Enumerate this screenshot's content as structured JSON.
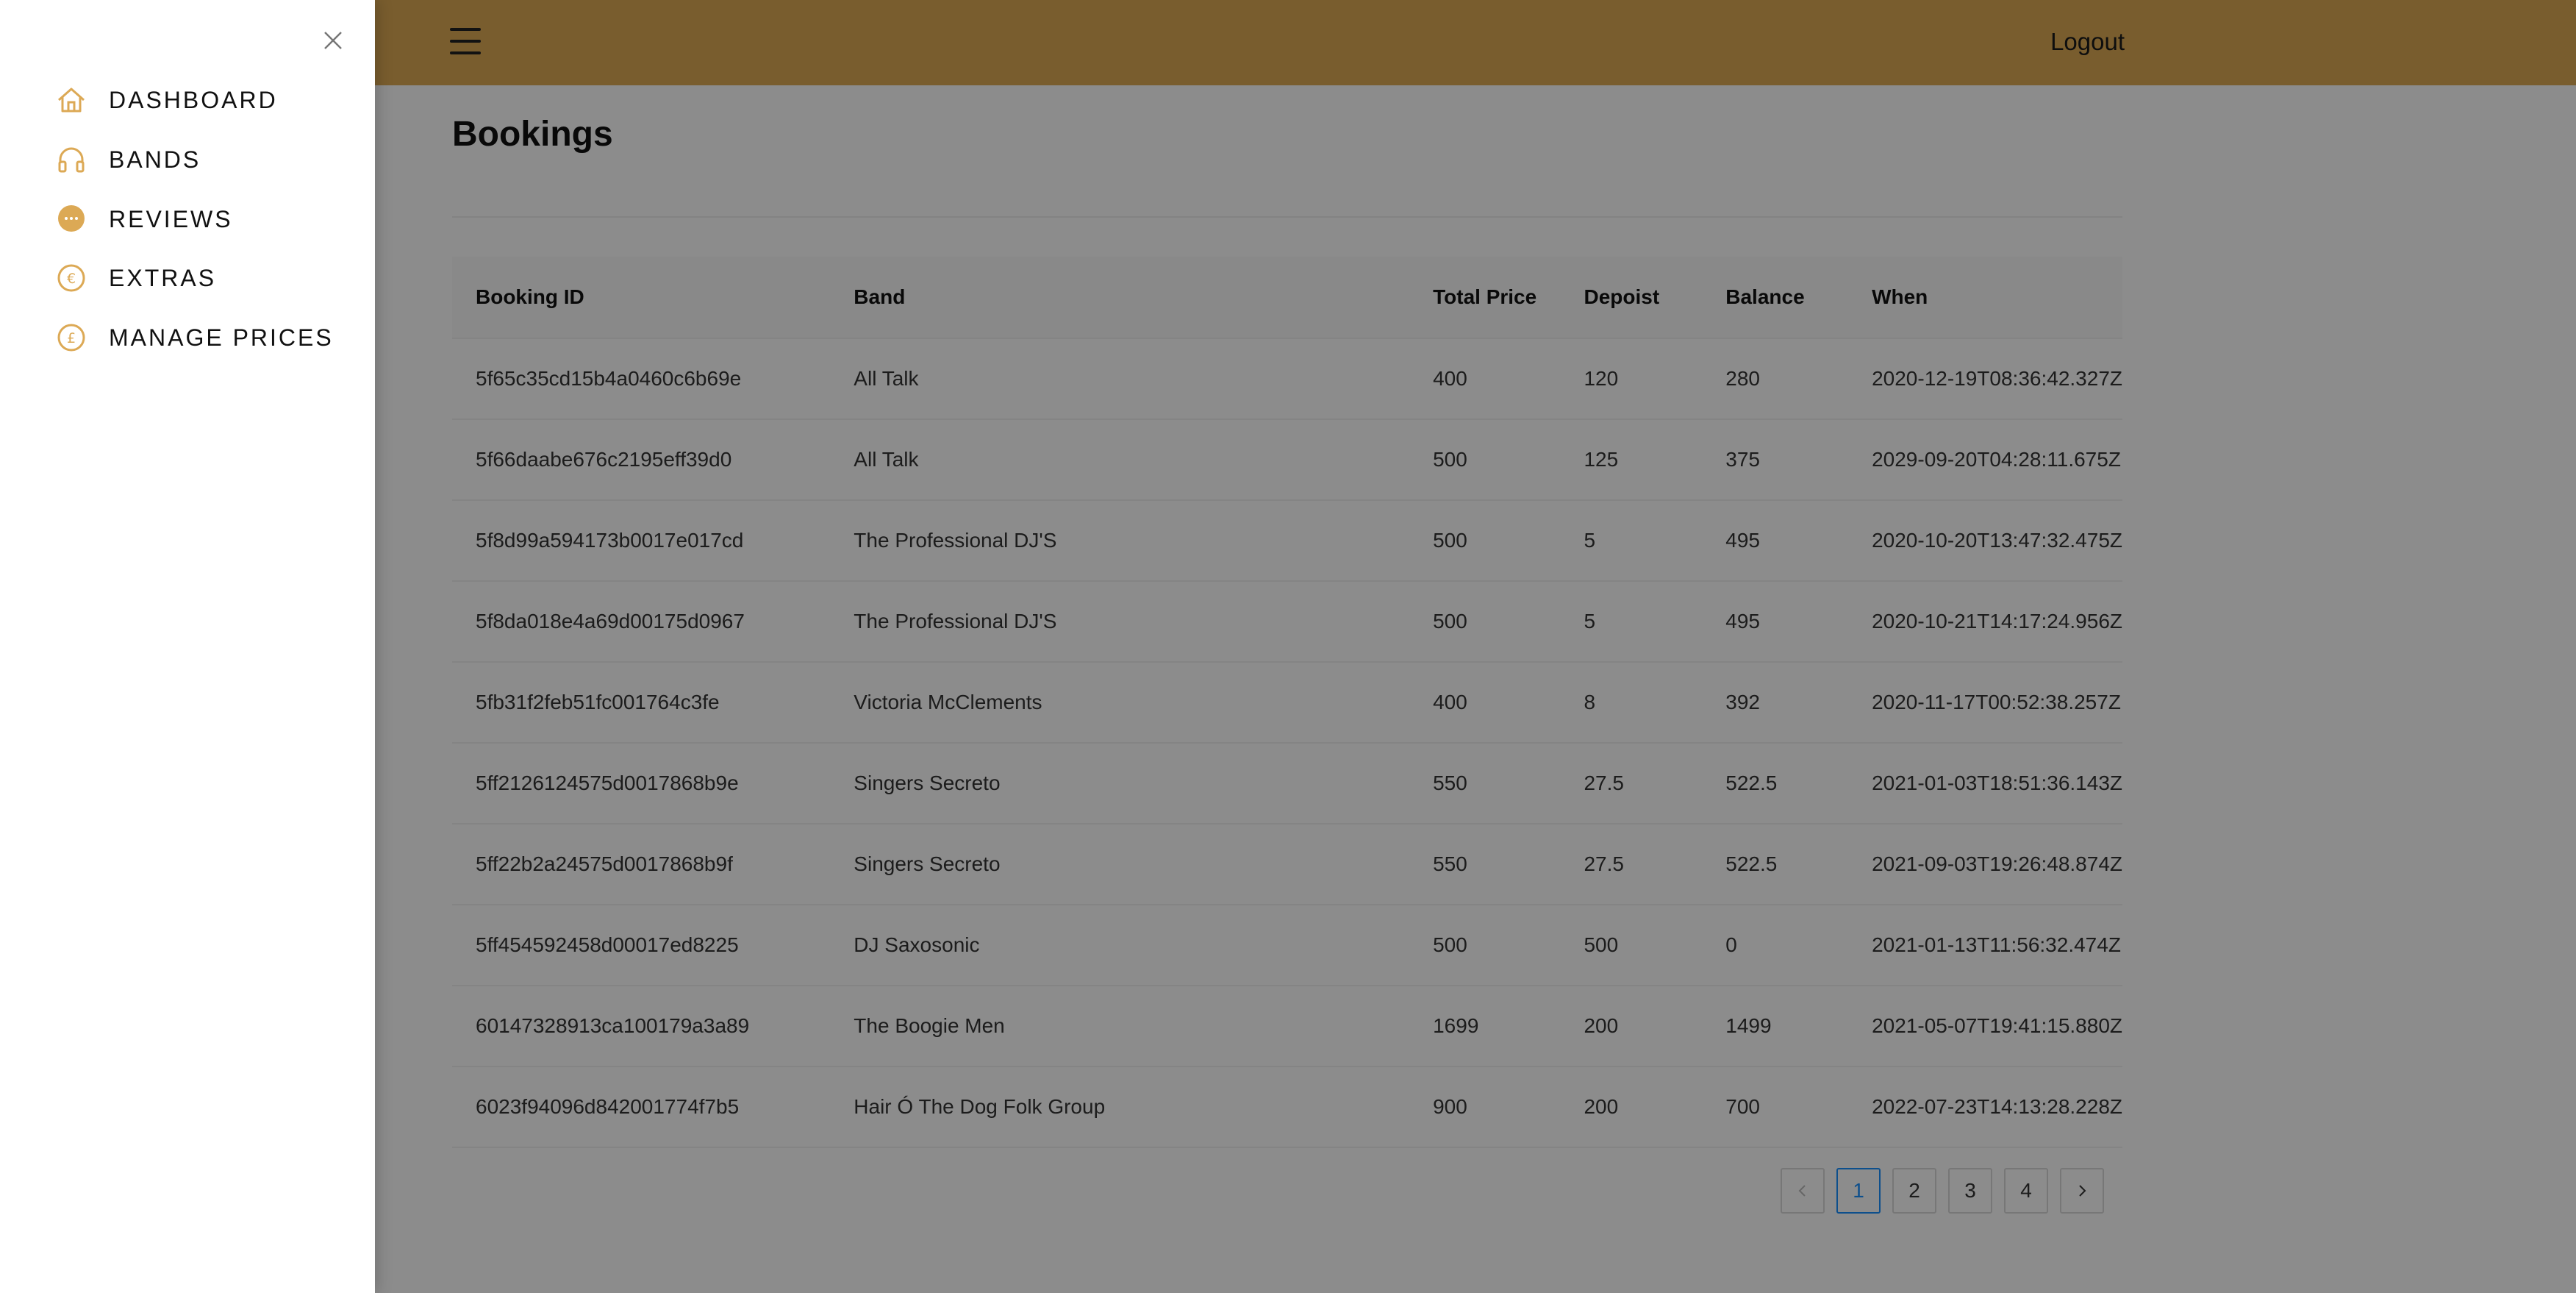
{
  "colors": {
    "accent": "#dca955",
    "header_bg": "#dca955",
    "pagination_active": "#1890ff",
    "mask": "rgba(0,0,0,0.45)"
  },
  "header": {
    "menu_icon": "hamburger-icon",
    "logout_label": "Logout"
  },
  "page": {
    "title": "Bookings"
  },
  "table": {
    "columns": [
      "Booking ID",
      "Band",
      "Total Price",
      "Depoist",
      "Balance",
      "When"
    ],
    "rows": [
      [
        "5f65c35cd15b4a0460c6b69e",
        "All Talk",
        "400",
        "120",
        "280",
        "2020-12-19T08:36:42.327Z"
      ],
      [
        "5f66daabe676c2195eff39d0",
        "All Talk",
        "500",
        "125",
        "375",
        "2029-09-20T04:28:11.675Z"
      ],
      [
        "5f8d99a594173b0017e017cd",
        "The Professional DJ'S",
        "500",
        "5",
        "495",
        "2020-10-20T13:47:32.475Z"
      ],
      [
        "5f8da018e4a69d00175d0967",
        "The Professional DJ'S",
        "500",
        "5",
        "495",
        "2020-10-21T14:17:24.956Z"
      ],
      [
        "5fb31f2feb51fc001764c3fe",
        "Victoria McClements",
        "400",
        "8",
        "392",
        "2020-11-17T00:52:38.257Z"
      ],
      [
        "5ff2126124575d0017868b9e",
        "Singers Secreto",
        "550",
        "27.5",
        "522.5",
        "2021-01-03T18:51:36.143Z"
      ],
      [
        "5ff22b2a24575d0017868b9f",
        "Singers Secreto",
        "550",
        "27.5",
        "522.5",
        "2021-09-03T19:26:48.874Z"
      ],
      [
        "5ff454592458d00017ed8225",
        "DJ Saxosonic",
        "500",
        "500",
        "0",
        "2021-01-13T11:56:32.474Z"
      ],
      [
        "60147328913ca100179a3a89",
        "The Boogie Men",
        "1699",
        "200",
        "1499",
        "2021-05-07T19:41:15.880Z"
      ],
      [
        "6023f94096d842001774f7b5",
        "Hair Ó The Dog Folk Group",
        "900",
        "200",
        "700",
        "2022-07-23T14:13:28.228Z"
      ]
    ]
  },
  "pagination": {
    "prev_icon": "chevron-left-icon",
    "next_icon": "chevron-right-icon",
    "pages": [
      "1",
      "2",
      "3",
      "4"
    ],
    "current": "1"
  },
  "drawer": {
    "close_icon": "close-icon",
    "items": [
      {
        "label": "DASHBOARD",
        "icon": "home-icon"
      },
      {
        "label": "BANDS",
        "icon": "headphones-icon"
      },
      {
        "label": "REVIEWS",
        "icon": "message-icon"
      },
      {
        "label": "EXTRAS",
        "icon": "euro-icon"
      },
      {
        "label": "MANAGE PRICES",
        "icon": "pound-icon"
      }
    ]
  }
}
